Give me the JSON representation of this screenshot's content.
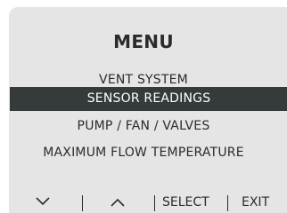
{
  "menu": {
    "title": "MENU",
    "items": [
      {
        "label": "VENT SYSTEM",
        "selected": false
      },
      {
        "label": "SENSOR READINGS",
        "selected": true
      },
      {
        "label": "PUMP / FAN / VALVES",
        "selected": false
      },
      {
        "label": "MAXIMUM FLOW TEMPERATURE",
        "selected": false
      }
    ]
  },
  "footer": {
    "down_icon": "chevron-down-icon",
    "up_icon": "chevron-up-icon",
    "select_label": "SELECT",
    "exit_label": "EXIT"
  },
  "colors": {
    "screen_background": "#e5e5e5",
    "selected_background": "#353a3a",
    "text": "#2b2b2b",
    "selected_text": "#ffffff"
  }
}
